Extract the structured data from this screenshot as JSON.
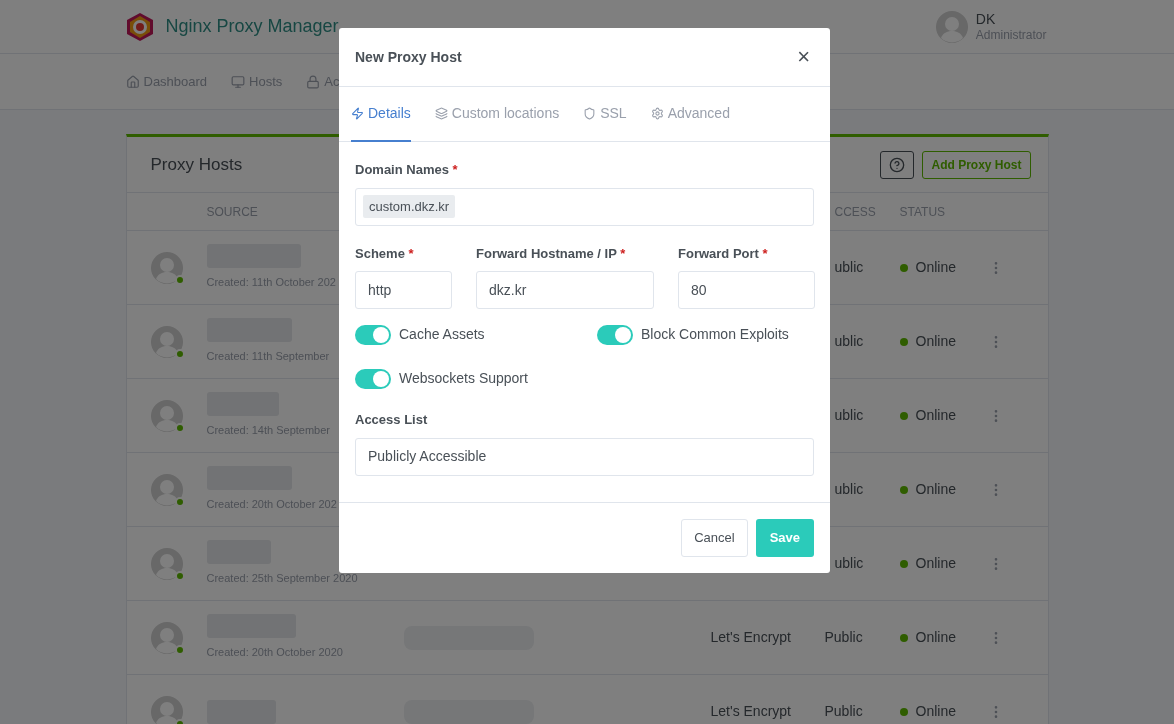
{
  "header": {
    "brand": "Nginx Proxy Manager",
    "user": {
      "name": "DK",
      "role": "Administrator"
    }
  },
  "nav": [
    {
      "label": "Dashboard"
    },
    {
      "label": "Hosts"
    },
    {
      "label": "Ac"
    }
  ],
  "card": {
    "title": "Proxy Hosts",
    "add_button": "Add Proxy Host",
    "columns": {
      "source": "SOURCE",
      "access": "CCESS",
      "status": "STATUS"
    },
    "rows": [
      {
        "created": "Created: 11th October 202",
        "access": "ublic",
        "status": "Online",
        "online": true
      },
      {
        "created": "Created: 11th September",
        "access": "ublic",
        "status": "Online",
        "online": true
      },
      {
        "created": "Created: 14th September",
        "access": "ublic",
        "status": "Online",
        "online": true
      },
      {
        "created": "Created: 20th October 202",
        "access": "ublic",
        "status": "Online",
        "online": true
      },
      {
        "created": "Created: 25th September 2020",
        "access": "ublic",
        "status": "Online",
        "online": true
      },
      {
        "created": "Created: 20th October 2020",
        "ssl": "Let's Encrypt",
        "access": "Public",
        "status": "Online",
        "online": true
      },
      {
        "ssl": "Let's Encrypt",
        "access": "Public",
        "status": "Online",
        "online": true
      }
    ]
  },
  "modal": {
    "title": "New Proxy Host",
    "close": "×",
    "tabs": [
      {
        "label": "Details",
        "selected": true
      },
      {
        "label": "Custom locations",
        "selected": false
      },
      {
        "label": "SSL",
        "selected": false
      },
      {
        "label": "Advanced",
        "selected": false
      }
    ],
    "domain": {
      "label": "Domain Names",
      "required": "*",
      "tags": [
        "custom.dkz.kr"
      ]
    },
    "scheme": {
      "label": "Scheme",
      "required": "*",
      "value": "http"
    },
    "hostname": {
      "label": "Forward Hostname / IP",
      "required": "*",
      "value": "dkz.kr"
    },
    "port": {
      "label": "Forward Port",
      "required": "*",
      "value": "80"
    },
    "toggles": [
      {
        "label": "Cache Assets",
        "on": true
      },
      {
        "label": "Block Common Exploits",
        "on": true
      },
      {
        "label": "Websockets Support",
        "on": true
      }
    ],
    "access_list": {
      "label": "Access List",
      "value": "Publicly Accessible"
    },
    "buttons": {
      "cancel": "Cancel",
      "save": "Save"
    }
  }
}
